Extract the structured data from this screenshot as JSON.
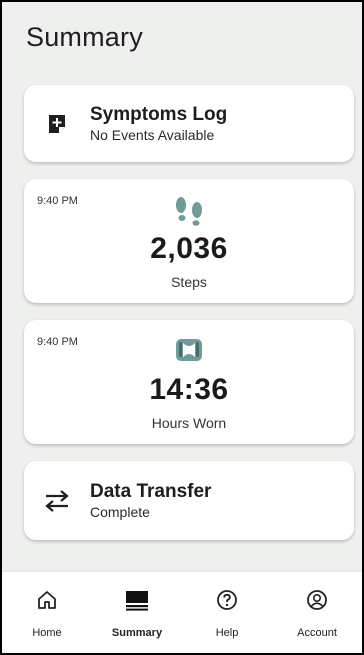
{
  "page": {
    "title": "Summary"
  },
  "cards": {
    "symptoms": {
      "title": "Symptoms Log",
      "subtitle": "No Events Available",
      "icon": "note-add-icon"
    },
    "steps": {
      "time": "9:40 PM",
      "value": "2,036",
      "label": "Steps",
      "icon": "footsteps-icon"
    },
    "hours": {
      "time": "9:40 PM",
      "value": "14:36",
      "label": "Hours Worn",
      "icon": "brace-icon"
    },
    "transfer": {
      "title": "Data Transfer",
      "subtitle": "Complete",
      "icon": "swap-arrows-icon"
    }
  },
  "tabs": [
    {
      "label": "Home",
      "icon": "home-icon",
      "active": false
    },
    {
      "label": "Summary",
      "icon": "summary-icon",
      "active": true
    },
    {
      "label": "Help",
      "icon": "help-icon",
      "active": false
    },
    {
      "label": "Account",
      "icon": "account-icon",
      "active": false
    }
  ],
  "colors": {
    "background": "#eef0ed",
    "accent": "#6f9b9a",
    "text": "#1d1d1d"
  }
}
